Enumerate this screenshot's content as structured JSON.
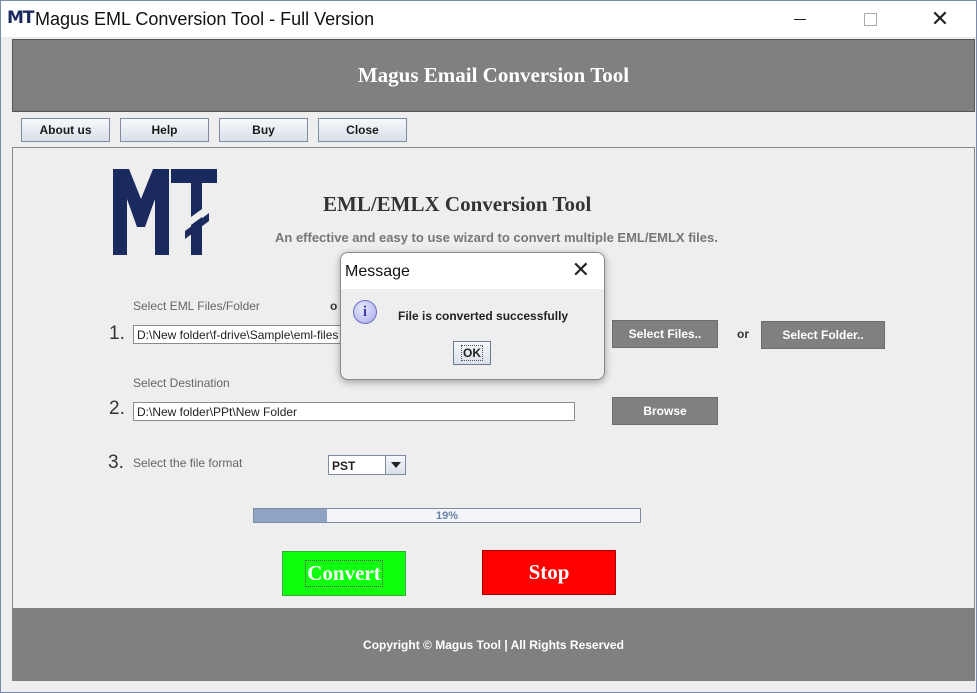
{
  "window": {
    "app_logo": "MT",
    "title": "Magus EML Conversion Tool - Full Version"
  },
  "header": {
    "title": "Magus Email Conversion Tool"
  },
  "toolbar": {
    "about_label": "About us",
    "help_label": "Help",
    "buy_label": "Buy",
    "close_label": "Close"
  },
  "main": {
    "tool_title": "EML/EMLX Conversion Tool",
    "tool_subtitle": "An effective and easy to use wizard to convert multiple EML/EMLX files.",
    "step1": {
      "number": "1.",
      "label": "Select EML Files/Folder",
      "label_tail": "o",
      "value": "D:\\New folder\\f-drive\\Sample\\eml-files",
      "select_files_label": "Select Files..",
      "or_label": "or",
      "select_folder_label": "Select Folder.."
    },
    "step2": {
      "number": "2.",
      "label": "Select Destination",
      "value": "D:\\New folder\\PPt\\New Folder",
      "browse_label": "Browse"
    },
    "step3": {
      "number": "3.",
      "label": "Select the file format",
      "selected_format": "PST"
    },
    "progress": {
      "percent": 19,
      "text": "19%"
    },
    "convert_label": "Convert",
    "stop_label": "Stop"
  },
  "footer": {
    "copyright": "Copyright © Magus Tool  |  All Rights Reserved"
  },
  "dialog": {
    "title": "Message",
    "message": "File is converted successfully",
    "ok_label": "OK"
  },
  "colors": {
    "banner_gray": "#808080",
    "convert_green": "#0fff0f",
    "stop_red": "#ff0000",
    "logo_navy": "#1a2a5e"
  }
}
